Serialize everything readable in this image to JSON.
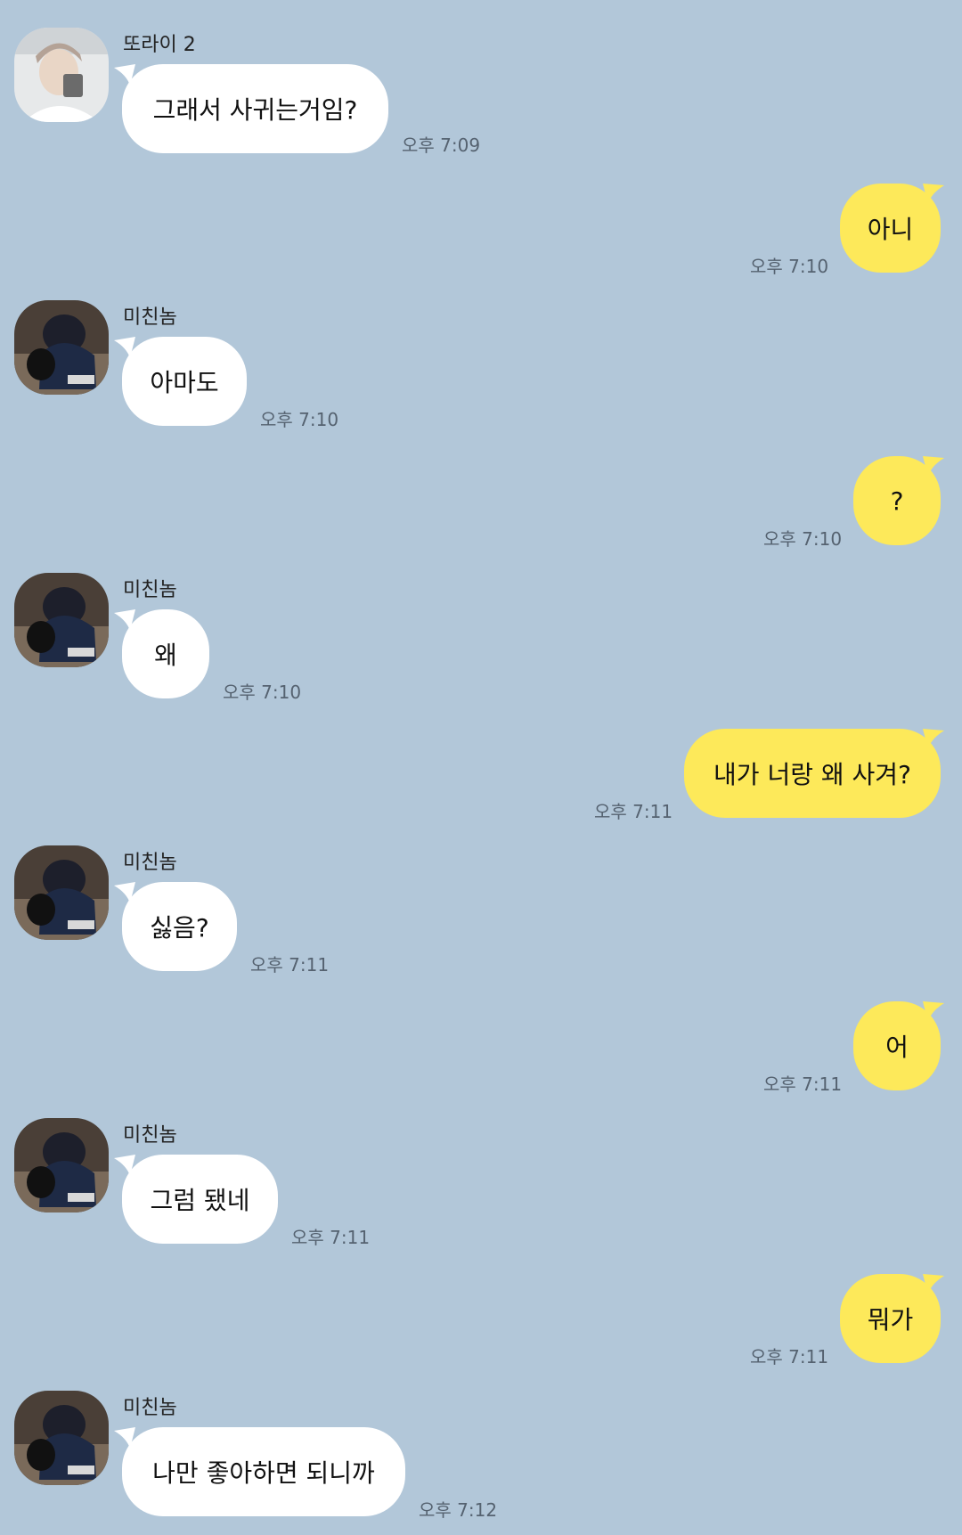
{
  "messages": [
    {
      "side": "in",
      "sender": "또라이 2",
      "text": "그래서 사귀는거임?",
      "time": "오후 7:09",
      "avatar": "avatar-a"
    },
    {
      "side": "out",
      "text": "아니",
      "time": "오후 7:10"
    },
    {
      "side": "in",
      "sender": "미친놈",
      "text": "아마도",
      "time": "오후 7:10",
      "avatar": "avatar-b"
    },
    {
      "side": "out",
      "text": "?",
      "time": "오후 7:10"
    },
    {
      "side": "in",
      "sender": "미친놈",
      "text": "왜",
      "time": "오후 7:10",
      "avatar": "avatar-b"
    },
    {
      "side": "out",
      "text": "내가 너랑 왜 사겨?",
      "time": "오후 7:11"
    },
    {
      "side": "in",
      "sender": "미친놈",
      "text": "싫음?",
      "time": "오후 7:11",
      "avatar": "avatar-b"
    },
    {
      "side": "out",
      "text": "어",
      "time": "오후 7:11"
    },
    {
      "side": "in",
      "sender": "미친놈",
      "text": "그럼 됐네",
      "time": "오후 7:11",
      "avatar": "avatar-b"
    },
    {
      "side": "out",
      "text": "뭐가",
      "time": "오후 7:11"
    },
    {
      "side": "in",
      "sender": "미친놈",
      "text": "나만 좋아하면 되니까",
      "time": "오후 7:12",
      "avatar": "avatar-b"
    }
  ],
  "colors": {
    "background": "#b2c7d9",
    "incoming_bubble": "#ffffff",
    "outgoing_bubble": "#fde95a",
    "timestamp": "#556270"
  }
}
